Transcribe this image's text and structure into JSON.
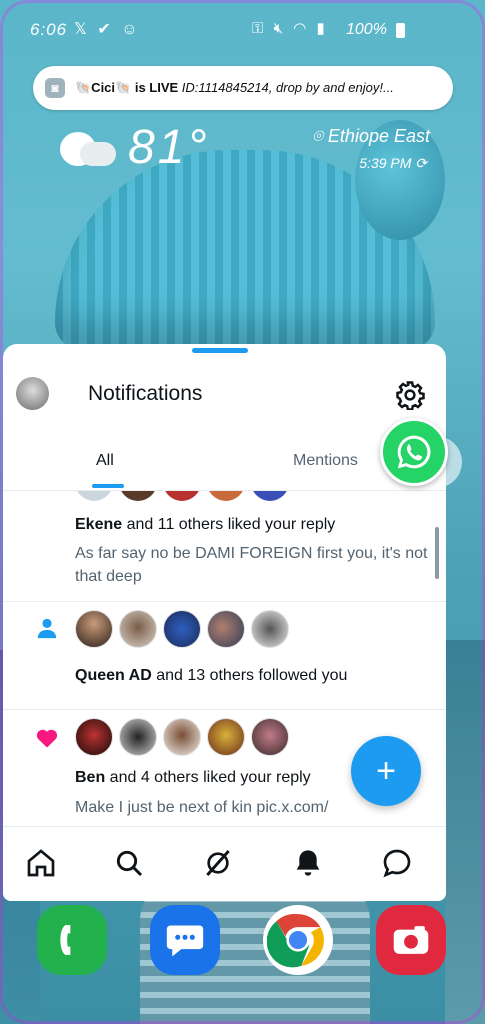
{
  "status_bar": {
    "time": "6:06",
    "battery": "100%"
  },
  "notification_pill": {
    "icon_name": "cici-app-icon",
    "text_bold": "🐚Cici🐚 is LIVE",
    "text": " ID:1114845214, drop by and enjoy!..."
  },
  "weather_widget": {
    "temperature": "81°",
    "location": "Ethiope East",
    "time": "5:39 PM"
  },
  "notifications_panel": {
    "title": "Notifications",
    "tabs": [
      {
        "label": "All",
        "selected": true
      },
      {
        "label": "Mentions",
        "selected": false
      }
    ],
    "items": [
      {
        "type": "like",
        "actor": "Ekene",
        "action": " and 11 others liked your reply",
        "preview": "As far say no be DAMI FOREIGN first you, it's not that deep"
      },
      {
        "type": "follow",
        "actor": "Queen AD",
        "action": " and 13 others followed you"
      },
      {
        "type": "like",
        "actor": "Ben",
        "action": " and 4 others liked your reply",
        "preview": "Make I just be next of kin pic.x.com/"
      }
    ],
    "compose_label": "+"
  },
  "colors": {
    "accent": "#1d9bf0",
    "like_pink": "#f91880",
    "text_primary": "#0f1419",
    "text_secondary": "#536471"
  },
  "bottom_nav": [
    {
      "icon": "home-icon"
    },
    {
      "icon": "search-icon"
    },
    {
      "icon": "grok-icon"
    },
    {
      "icon": "bell-icon"
    },
    {
      "icon": "messages-icon"
    }
  ],
  "dock": [
    {
      "icon": "phone-app-icon"
    },
    {
      "icon": "messages-app-icon"
    },
    {
      "icon": "chrome-app-icon"
    },
    {
      "icon": "camera-app-icon"
    }
  ]
}
